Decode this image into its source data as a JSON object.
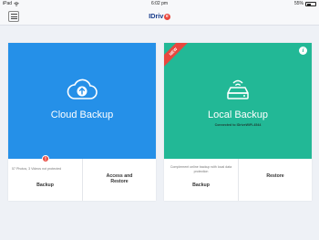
{
  "status_bar": {
    "device": "iPad",
    "time": "6:02 pm",
    "battery": "55%"
  },
  "nav": {
    "logo_main": "IDriv",
    "logo_e": "e"
  },
  "cloud_card": {
    "title": "Cloud Backup",
    "badge": "!",
    "backup_info": "57 Photos, 3 Videos not protected",
    "backup_label": "Backup",
    "access_line1": "Access and",
    "access_line2": "Restore"
  },
  "local_card": {
    "ribbon": "NEW",
    "info_glyph": "i",
    "title": "Local Backup",
    "subtitle": "Connected to IDriveWiFi-4544",
    "backup_info": "Complement online backup with local data protection",
    "backup_label": "Backup",
    "restore_label": "Restore"
  },
  "colors": {
    "cloud_blue": "#2590e8",
    "local_green": "#22b896",
    "alert_red": "#e8473e"
  }
}
